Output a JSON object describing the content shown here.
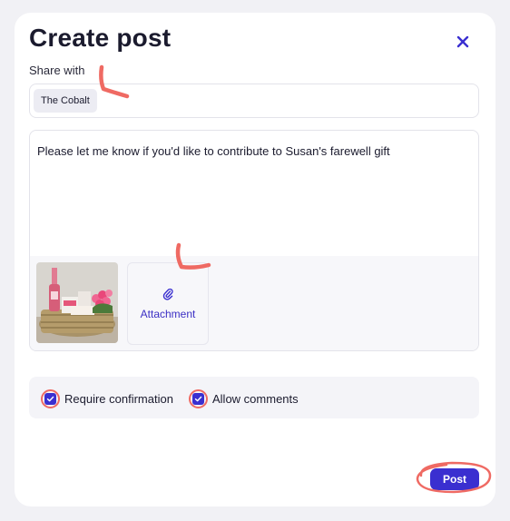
{
  "dialog": {
    "title": "Create post",
    "close_icon": "close-icon"
  },
  "share": {
    "label": "Share with",
    "chip": "The Cobalt"
  },
  "message": {
    "text": "Please let me know if you'd like to contribute to Susan's farewell gift"
  },
  "attachments": {
    "thumbnail_icon": "gift-basket-image",
    "button_icon": "paperclip-icon",
    "button_label": "Attachment"
  },
  "options": {
    "require_confirmation": {
      "label": "Require confirmation",
      "checked": true
    },
    "allow_comments": {
      "label": "Allow comments",
      "checked": true
    }
  },
  "actions": {
    "post_label": "Post"
  },
  "colors": {
    "accent": "#3a2fd0",
    "annotation": "#ef6a63"
  }
}
